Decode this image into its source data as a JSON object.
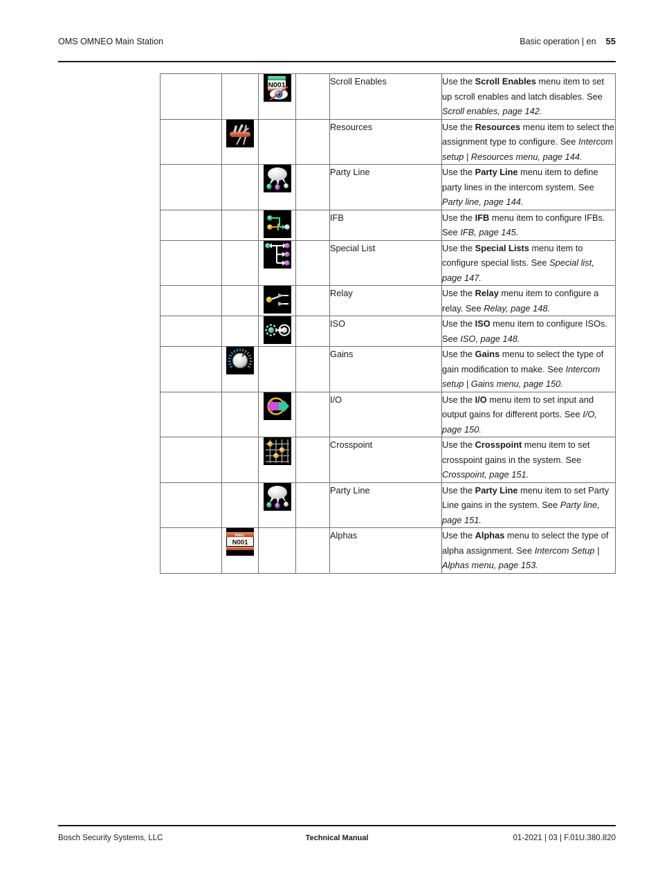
{
  "header": {
    "left": "OMS OMNEO Main Station",
    "right": "Basic operation | en",
    "page_number": "55"
  },
  "footer": {
    "left": "Bosch Security Systems, LLC",
    "center": "Technical Manual",
    "right": "01-2021 | 03 | F.01U.380.820"
  },
  "colors": {
    "rule": "#1a1a1a",
    "table_border": "#6f6f6f",
    "text": "#1a1a1a",
    "icon_bg": "#000000",
    "green_node": "#29c38f",
    "purple_node": "#b84fd6",
    "white_node": "#e8e8e8",
    "gold_node": "#e8a317",
    "orange_handle": "#d96a4a",
    "knob_blue": "#2fa8e0",
    "eye_blue": "#3a7fd5",
    "slash_red": "#cc4a2a"
  },
  "table": {
    "columns": 6,
    "rows": [
      {
        "icon_column": 3,
        "icon": "scroll-enables-icon",
        "name": "Scroll Enables",
        "desc_parts": [
          {
            "t": "Use the ",
            "s": "normal"
          },
          {
            "t": "Scroll Enables",
            "s": "bold"
          },
          {
            "t": " menu item to set up scroll enables and latch disables. See ",
            "s": "normal"
          },
          {
            "t": "Scroll enables, page 142.",
            "s": "italic"
          }
        ]
      },
      {
        "icon_column": 2,
        "icon": "resources-icon",
        "name": "Resources",
        "desc_parts": [
          {
            "t": "Use the ",
            "s": "normal"
          },
          {
            "t": "Resources",
            "s": "bold"
          },
          {
            "t": " menu item to select the assignment type to configure. See ",
            "s": "normal"
          },
          {
            "t": "Intercom setup | Resources menu, page 144.",
            "s": "italic"
          }
        ]
      },
      {
        "icon_column": 3,
        "icon": "party-line-icon",
        "name": "Party Line",
        "desc_parts": [
          {
            "t": "Use the ",
            "s": "normal"
          },
          {
            "t": "Party Line",
            "s": "bold"
          },
          {
            "t": " menu item to define party lines in the intercom system. See ",
            "s": "normal"
          },
          {
            "t": "Party line, page 144.",
            "s": "italic"
          }
        ]
      },
      {
        "icon_column": 3,
        "icon": "ifb-icon",
        "name": "IFB",
        "desc_parts": [
          {
            "t": "Use the ",
            "s": "normal"
          },
          {
            "t": "IFB",
            "s": "bold"
          },
          {
            "t": " menu item to configure IFBs. See ",
            "s": "normal"
          },
          {
            "t": "IFB, page 145.",
            "s": "italic"
          }
        ]
      },
      {
        "icon_column": 3,
        "icon": "special-list-icon",
        "name": "Special List",
        "desc_parts": [
          {
            "t": "Use the ",
            "s": "normal"
          },
          {
            "t": "Special Lists",
            "s": "bold"
          },
          {
            "t": " menu item to configure special lists. See ",
            "s": "normal"
          },
          {
            "t": "Special list, page 147.",
            "s": "italic"
          }
        ]
      },
      {
        "icon_column": 3,
        "icon": "relay-icon",
        "name": "Relay",
        "desc_parts": [
          {
            "t": "Use the ",
            "s": "normal"
          },
          {
            "t": "Relay",
            "s": "bold"
          },
          {
            "t": " menu item to configure a relay. See ",
            "s": "normal"
          },
          {
            "t": "Relay, page 148.",
            "s": "italic"
          }
        ]
      },
      {
        "icon_column": 3,
        "icon": "iso-icon",
        "name": "ISO",
        "desc_parts": [
          {
            "t": "Use the ",
            "s": "normal"
          },
          {
            "t": "ISO",
            "s": "bold"
          },
          {
            "t": " menu item to configure ISOs. See ",
            "s": "normal"
          },
          {
            "t": "ISO, page 148.",
            "s": "italic"
          }
        ]
      },
      {
        "icon_column": 2,
        "icon": "gains-knob-icon",
        "name": "Gains",
        "desc_parts": [
          {
            "t": "Use the ",
            "s": "normal"
          },
          {
            "t": "Gains",
            "s": "bold"
          },
          {
            "t": " menu to select the type of gain modification to make. See ",
            "s": "normal"
          },
          {
            "t": "Intercom setup | Gains menu, page 150.",
            "s": "italic"
          }
        ]
      },
      {
        "icon_column": 3,
        "icon": "io-icon",
        "name": "I/O",
        "desc_parts": [
          {
            "t": "Use the ",
            "s": "normal"
          },
          {
            "t": "I/O",
            "s": "bold"
          },
          {
            "t": " menu item to set input and output gains for different ports. See ",
            "s": "normal"
          },
          {
            "t": "I/O, page 150.",
            "s": "italic"
          }
        ]
      },
      {
        "icon_column": 3,
        "icon": "crosspoint-icon",
        "name": "Crosspoint",
        "desc_parts": [
          {
            "t": "Use the ",
            "s": "normal"
          },
          {
            "t": "Crosspoint",
            "s": "bold"
          },
          {
            "t": " menu item to set crosspoint gains in the system. See ",
            "s": "normal"
          },
          {
            "t": "Crosspoint, page 151.",
            "s": "italic"
          }
        ]
      },
      {
        "icon_column": 3,
        "icon": "party-line-icon",
        "name": "Party Line",
        "desc_parts": [
          {
            "t": "Use the ",
            "s": "normal"
          },
          {
            "t": "Party Line",
            "s": "bold"
          },
          {
            "t": " menu item to set Party Line gains in the system. See ",
            "s": "normal"
          },
          {
            "t": "Party line, page 151.",
            "s": "italic"
          }
        ]
      },
      {
        "icon_column": 2,
        "icon": "alphas-icon",
        "name": "Alphas",
        "desc_parts": [
          {
            "t": "Use the ",
            "s": "normal"
          },
          {
            "t": "Alphas",
            "s": "bold"
          },
          {
            "t": " menu to select the type of alpha assignment. See ",
            "s": "normal"
          },
          {
            "t": "Intercom Setup | Alphas menu, page 153.",
            "s": "italic"
          }
        ]
      }
    ]
  },
  "icon_labels": {
    "scroll_enables_key": "N001",
    "alphas_top": "Hello..",
    "alphas_key": "N001"
  }
}
